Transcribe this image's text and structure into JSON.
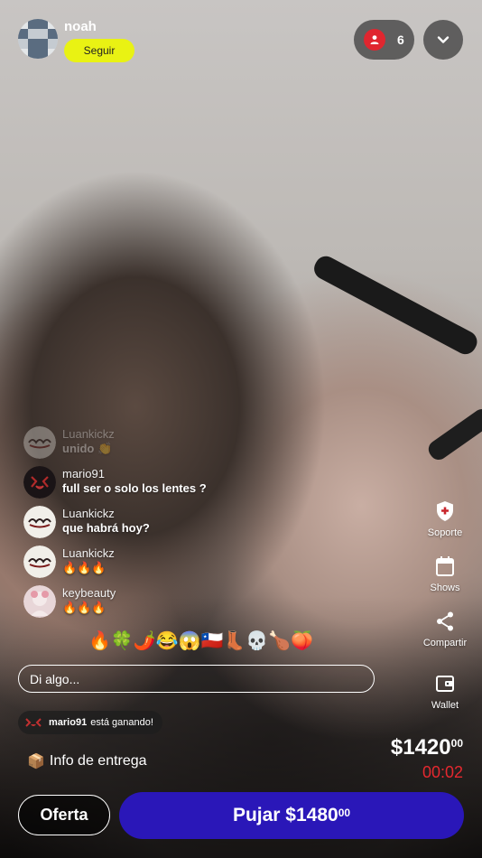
{
  "host": {
    "name": "noah",
    "follow_label": "Seguir"
  },
  "viewers": {
    "count": "6",
    "icon": "person-icon"
  },
  "actions": [
    {
      "label": "Soporte",
      "icon": "shield-plus-icon"
    },
    {
      "label": "Shows",
      "icon": "calendar-icon"
    },
    {
      "label": "Compartir",
      "icon": "share-icon"
    },
    {
      "label": "Wallet",
      "icon": "wallet-icon"
    }
  ],
  "chat": {
    "messages": [
      {
        "user": "Luankickz",
        "text": "unido 👏"
      },
      {
        "user": "mario91",
        "text": "full ser o solo los lentes ?"
      },
      {
        "user": "Luankickz",
        "text": "que habrá hoy?"
      },
      {
        "user": "Luankickz",
        "text": "🔥🔥🔥"
      },
      {
        "user": "keybeauty",
        "text": "🔥🔥🔥"
      }
    ],
    "reactions": "🔥🍀🌶️😂😱🇨🇱👢💀🍗🍑",
    "input_placeholder": "Di algo..."
  },
  "winning": {
    "user": "mario91",
    "text": "está ganando!"
  },
  "delivery": {
    "label": "Info de entrega",
    "icon": "package-icon"
  },
  "auction": {
    "price_main": "$1420",
    "price_cents": "00",
    "timer": "00:02",
    "offer_label": "Oferta",
    "bid_label": "Pujar $1480",
    "bid_cents": "00"
  },
  "colors": {
    "follow": "#e9f213",
    "bid": "#2a17b8",
    "timer": "#e5282f",
    "viewer_badge": "#e0262f"
  }
}
